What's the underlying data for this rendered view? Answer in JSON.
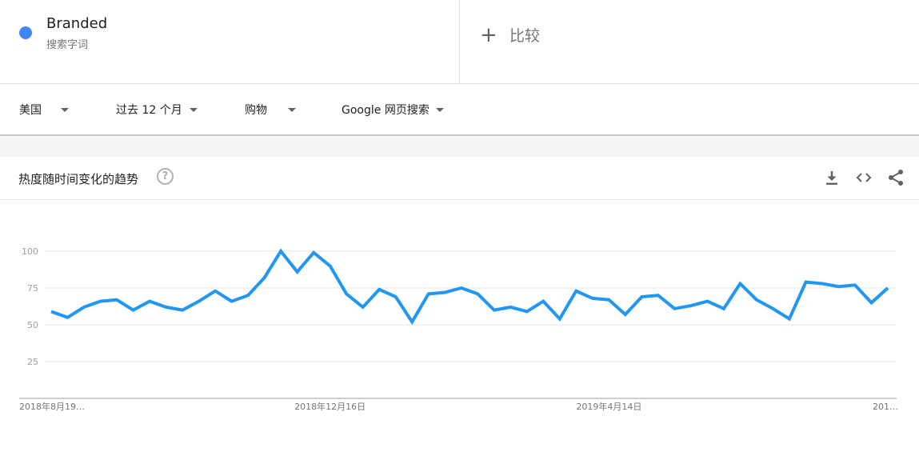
{
  "term": {
    "name": "Branded",
    "subtitle": "搜索字词",
    "color": "#4285f4"
  },
  "compare": {
    "icon": "plus-icon",
    "label": "比较"
  },
  "filters": {
    "region": "美国",
    "time": "过去 12 个月",
    "category": "购物",
    "source": "Google 网页搜索"
  },
  "card": {
    "title": "热度随时间变化的趋势",
    "help_icon": "?",
    "icons": [
      "download-icon",
      "embed-icon",
      "share-icon"
    ]
  },
  "chart_data": {
    "type": "line",
    "title": "",
    "xlabel": "",
    "ylabel": "",
    "ylim": [
      0,
      100
    ],
    "yticks": [
      "100",
      "75",
      "50",
      "25"
    ],
    "grid": true,
    "line_color": "#2196f3",
    "x_labels": [
      "2018年8月19…",
      "2018年12月16日",
      "2019年4月14日",
      "201…"
    ],
    "x_label_indices": [
      0,
      17,
      34,
      51
    ],
    "series": [
      {
        "values": [
          59,
          55,
          62,
          66,
          67,
          60,
          66,
          62,
          60,
          66,
          73,
          66,
          70,
          82,
          100,
          86,
          99,
          90,
          71,
          62,
          74,
          69,
          52,
          71,
          72,
          75,
          71,
          60,
          62,
          59,
          66,
          54,
          73,
          68,
          67,
          57,
          69,
          70,
          61,
          63,
          66,
          61,
          78,
          67,
          61,
          54,
          79,
          78,
          76,
          77,
          65,
          75
        ]
      }
    ]
  }
}
